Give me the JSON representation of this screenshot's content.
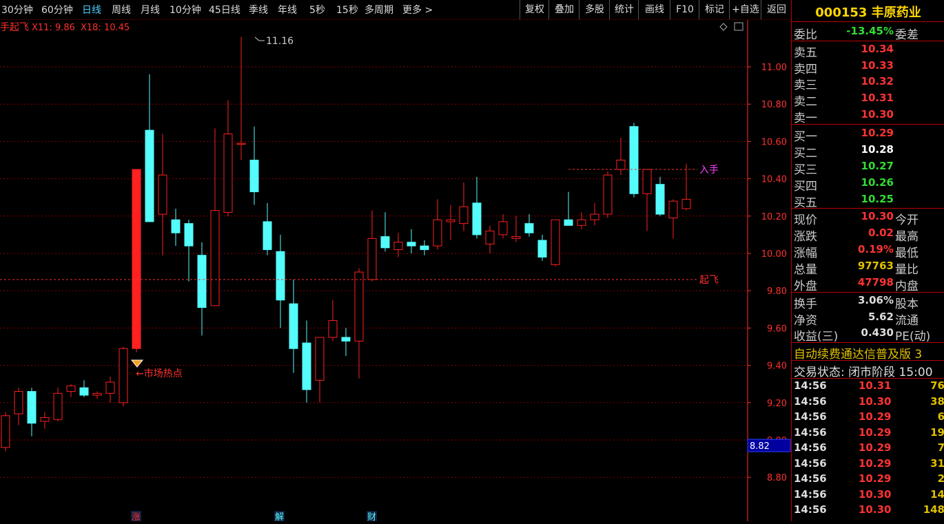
{
  "toolbar": {
    "periods": [
      "30分钟",
      "60分钟",
      "日线",
      "周线",
      "月线",
      "10分钟",
      "45日线",
      "季线",
      "年线",
      "5秒",
      "15秒",
      "多周期",
      "更多 >"
    ],
    "active": "日线",
    "tools": [
      "复权",
      "叠加",
      "多股",
      "统计",
      "画线",
      "F10",
      "标记",
      "+自选",
      "返回"
    ]
  },
  "chart": {
    "indicator_name": "手起飞",
    "ma_label_1": "X11: 9.86",
    "ma_label_2": "X18: 10.45",
    "high_marker": "11.16",
    "hot_label": "←市场热点",
    "buy_label": "入手",
    "fly_label": "起飞",
    "current_price_tag": "8.82",
    "markers": [
      "涨",
      "解",
      "财"
    ],
    "colors": {
      "up": "#ff2020",
      "down": "#54fcfc",
      "grid": "#8b0000",
      "axis": "#ff3030"
    }
  },
  "chart_data": {
    "type": "candlestick",
    "y_ticks": [
      "11.00",
      "10.80",
      "10.60",
      "10.40",
      "10.20",
      "10.00",
      "9.80",
      "9.60",
      "9.40",
      "9.20",
      "9.00",
      "8.80"
    ],
    "ylim": [
      8.72,
      11.25
    ],
    "lines": [
      {
        "name": "入手",
        "value": 10.45
      },
      {
        "name": "起飞",
        "value": 9.86
      }
    ],
    "candles": [
      [
        8.96,
        9.15,
        8.94,
        9.13
      ],
      [
        9.14,
        9.28,
        9.08,
        9.26
      ],
      [
        9.26,
        9.28,
        9.02,
        9.09
      ],
      [
        9.1,
        9.15,
        9.06,
        9.12
      ],
      [
        9.11,
        9.28,
        9.1,
        9.25
      ],
      [
        9.26,
        9.3,
        9.23,
        9.29
      ],
      [
        9.28,
        9.32,
        9.23,
        9.24
      ],
      [
        9.24,
        9.26,
        9.22,
        9.25
      ],
      [
        9.25,
        9.34,
        9.2,
        9.31
      ],
      [
        9.2,
        9.5,
        9.18,
        9.49
      ],
      [
        9.49,
        10.45,
        9.47,
        10.45
      ],
      [
        10.66,
        10.96,
        10.17,
        10.17
      ],
      [
        10.21,
        10.64,
        9.99,
        10.42
      ],
      [
        10.18,
        10.24,
        10.04,
        10.11
      ],
      [
        10.16,
        10.18,
        9.85,
        10.04
      ],
      [
        9.99,
        10.06,
        9.56,
        9.71
      ],
      [
        9.72,
        10.67,
        9.72,
        10.23
      ],
      [
        10.22,
        10.82,
        10.2,
        10.64
      ],
      [
        10.59,
        11.16,
        10.5,
        10.59
      ],
      [
        10.5,
        10.68,
        10.26,
        10.33
      ],
      [
        10.17,
        10.27,
        9.99,
        10.02
      ],
      [
        10.01,
        10.1,
        9.6,
        9.75
      ],
      [
        9.73,
        9.86,
        9.36,
        9.49
      ],
      [
        9.52,
        9.64,
        9.2,
        9.27
      ],
      [
        9.32,
        9.55,
        9.2,
        9.55
      ],
      [
        9.55,
        9.75,
        9.53,
        9.64
      ],
      [
        9.55,
        9.6,
        9.45,
        9.53
      ],
      [
        9.53,
        9.92,
        9.33,
        9.9
      ],
      [
        9.86,
        10.23,
        9.85,
        10.08
      ],
      [
        10.09,
        10.22,
        10.01,
        10.03
      ],
      [
        10.02,
        10.11,
        9.98,
        10.06
      ],
      [
        10.06,
        10.13,
        10.0,
        10.04
      ],
      [
        10.04,
        10.07,
        9.99,
        10.02
      ],
      [
        10.04,
        10.29,
        10.02,
        10.18
      ],
      [
        10.17,
        10.26,
        10.07,
        10.18
      ],
      [
        10.16,
        10.38,
        10.12,
        10.25
      ],
      [
        10.27,
        10.41,
        10.08,
        10.1
      ],
      [
        10.05,
        10.15,
        10.0,
        10.12
      ],
      [
        10.1,
        10.21,
        10.08,
        10.17
      ],
      [
        10.08,
        10.2,
        10.06,
        10.09
      ],
      [
        10.16,
        10.21,
        10.09,
        10.11
      ],
      [
        10.07,
        10.1,
        9.96,
        9.98
      ],
      [
        9.94,
        10.18,
        9.93,
        10.18
      ],
      [
        10.18,
        10.33,
        10.15,
        10.15
      ],
      [
        10.15,
        10.22,
        10.13,
        10.18
      ],
      [
        10.18,
        10.27,
        10.15,
        10.21
      ],
      [
        10.21,
        10.44,
        10.19,
        10.42
      ],
      [
        10.45,
        10.62,
        10.42,
        10.5
      ],
      [
        10.68,
        10.7,
        10.3,
        10.32
      ],
      [
        10.32,
        10.45,
        10.12,
        10.45
      ],
      [
        10.37,
        10.41,
        10.2,
        10.21
      ],
      [
        10.19,
        10.29,
        10.08,
        10.28
      ],
      [
        10.24,
        10.48,
        10.23,
        10.29
      ]
    ]
  },
  "quote": {
    "code_name": "000153 丰原药业",
    "weibi_label": "委比",
    "weibi_value": "-13.45%",
    "weicha_label": "委差",
    "sell": [
      {
        "label": "卖五",
        "price": "10.34"
      },
      {
        "label": "卖四",
        "price": "10.33"
      },
      {
        "label": "卖三",
        "price": "10.32"
      },
      {
        "label": "卖二",
        "price": "10.31"
      },
      {
        "label": "卖一",
        "price": "10.30"
      }
    ],
    "buy": [
      {
        "label": "买一",
        "price": "10.29",
        "color": "#ff3333"
      },
      {
        "label": "买二",
        "price": "10.28",
        "color": "#ffffff"
      },
      {
        "label": "买三",
        "price": "10.27",
        "color": "#33dd33"
      },
      {
        "label": "买四",
        "price": "10.26",
        "color": "#33dd33"
      },
      {
        "label": "买五",
        "price": "10.25",
        "color": "#33dd33"
      }
    ],
    "stats": [
      {
        "l": "现价",
        "v": "10.30",
        "r": "今开",
        "c": "#ff3333"
      },
      {
        "l": "涨跌",
        "v": "0.02",
        "r": "最高",
        "c": "#ff3333"
      },
      {
        "l": "涨幅",
        "v": "0.19%",
        "r": "最低",
        "c": "#ff3333"
      },
      {
        "l": "总量",
        "v": "97763",
        "r": "量比",
        "c": "#e0c000"
      },
      {
        "l": "外盘",
        "v": "47798",
        "r": "内盘",
        "c": "#ff3333"
      }
    ],
    "stats2": [
      {
        "l": "换手",
        "v": "3.06%",
        "r": "股本"
      },
      {
        "l": "净资",
        "v": "5.62",
        "r": "流通"
      },
      {
        "l": "收益(三)",
        "v": "0.430",
        "r": "PE(动)"
      }
    ],
    "banner": "自动续费通达信普及版 3",
    "trade_status": "交易状态: 闭市阶段 15:00",
    "ticks": [
      {
        "t": "14:56",
        "p": "10.31",
        "v": "76"
      },
      {
        "t": "14:56",
        "p": "10.30",
        "v": "38"
      },
      {
        "t": "14:56",
        "p": "10.29",
        "v": "6"
      },
      {
        "t": "14:56",
        "p": "10.29",
        "v": "19"
      },
      {
        "t": "14:56",
        "p": "10.29",
        "v": "7"
      },
      {
        "t": "14:56",
        "p": "10.29",
        "v": "31"
      },
      {
        "t": "14:56",
        "p": "10.29",
        "v": "2"
      },
      {
        "t": "14:56",
        "p": "10.30",
        "v": "14"
      },
      {
        "t": "14:56",
        "p": "10.30",
        "v": "148"
      }
    ]
  }
}
